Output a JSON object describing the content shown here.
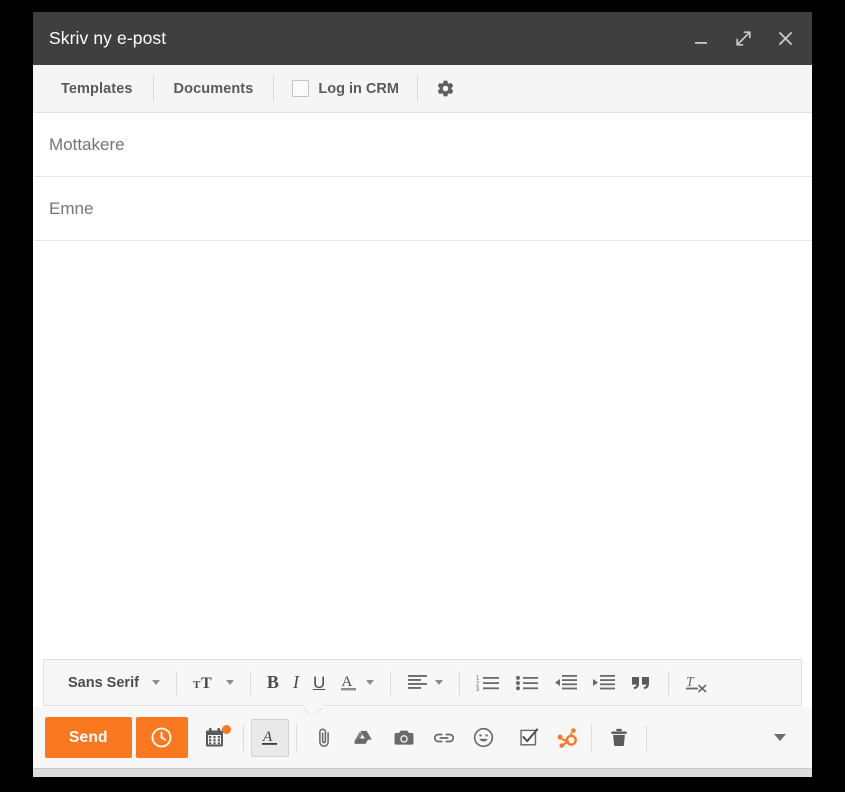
{
  "window": {
    "title": "Skriv ny e-post",
    "controls": [
      {
        "name": "minimize-button",
        "icon": "minimize-icon"
      },
      {
        "name": "expand-button",
        "icon": "expand-arrows-icon"
      },
      {
        "name": "close-button",
        "icon": "close-icon"
      }
    ]
  },
  "extension_toolbar": {
    "templates_label": "Templates",
    "documents_label": "Documents",
    "log_in_crm_label": "Log in CRM",
    "log_in_crm_checked": false,
    "settings_icon": "gear-icon"
  },
  "fields": {
    "recipients_placeholder": "Mottakere",
    "recipients_value": "",
    "subject_placeholder": "Emne",
    "subject_value": ""
  },
  "body": {
    "value": ""
  },
  "format_toolbar": {
    "font_family_label": "Sans Serif",
    "items": [
      {
        "name": "font-family-dropdown",
        "label": "Sans Serif",
        "icon": "chevron-down-icon"
      },
      {
        "name": "font-size-button",
        "label": "",
        "icon": "font-size-icon"
      },
      {
        "name": "bold-button",
        "label": "B",
        "icon": "bold-icon"
      },
      {
        "name": "italic-button",
        "label": "I",
        "icon": "italic-icon"
      },
      {
        "name": "underline-button",
        "label": "U",
        "icon": "underline-icon"
      },
      {
        "name": "text-color-button",
        "label": "A",
        "icon": "text-color-icon"
      },
      {
        "name": "align-button",
        "label": "",
        "icon": "align-left-icon"
      },
      {
        "name": "numbered-list-button",
        "label": "",
        "icon": "numbered-list-icon"
      },
      {
        "name": "bulleted-list-button",
        "label": "",
        "icon": "bulleted-list-icon"
      },
      {
        "name": "decrease-indent-button",
        "label": "",
        "icon": "decrease-indent-icon"
      },
      {
        "name": "increase-indent-button",
        "label": "",
        "icon": "increase-indent-icon"
      },
      {
        "name": "quote-button",
        "label": "",
        "icon": "quote-icon"
      },
      {
        "name": "remove-formatting-button",
        "label": "",
        "icon": "remove-formatting-icon"
      }
    ]
  },
  "action_bar": {
    "send_label": "Send",
    "schedule_icon": "clock-icon",
    "meetings_icon": "calendar-icon",
    "meetings_badge": true,
    "formatting_icon": "format-text-icon",
    "formatting_active": true,
    "attach_icon": "paperclip-icon",
    "drive_icon": "google-drive-icon",
    "photo_icon": "camera-icon",
    "link_icon": "link-icon",
    "emoji_icon": "emoji-icon",
    "task_icon": "checkbox-task-icon",
    "hubspot_icon": "hubspot-sprocket-icon",
    "discard_icon": "trash-icon",
    "more_icon": "chevron-down-icon"
  },
  "colors": {
    "accent_orange": "#fa7820",
    "titlebar_bg": "#3f3f3f",
    "toolbar_bg": "#f5f5f5",
    "icon_gray": "#5a5a5a"
  }
}
